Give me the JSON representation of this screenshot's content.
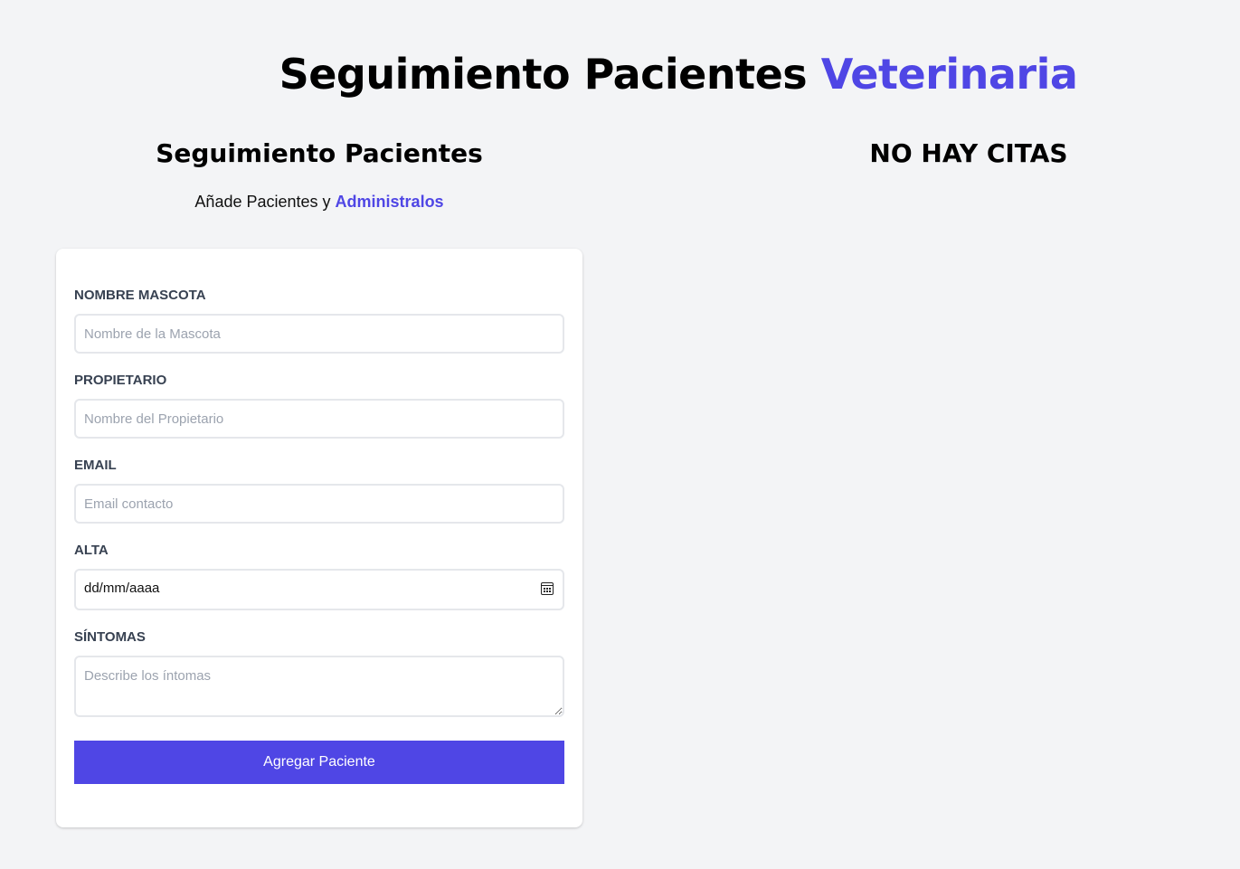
{
  "header": {
    "title_main": "Seguimiento Pacientes",
    "title_accent": "Veterinaria"
  },
  "form_section": {
    "title": "Seguimiento Pacientes",
    "tagline_text": "Añade Pacientes y",
    "tagline_accent": "Administralos"
  },
  "form": {
    "fields": [
      {
        "label": "Nombre Mascota",
        "placeholder": "Nombre de la Mascota",
        "value": ""
      },
      {
        "label": "Propietario",
        "placeholder": "Nombre del Propietario",
        "value": ""
      },
      {
        "label": "Email",
        "placeholder": "Email contacto",
        "value": ""
      },
      {
        "label": "Alta",
        "display_value": "dd/mm/aaaa",
        "icon": "calendar-icon"
      },
      {
        "label": "Síntomas",
        "placeholder": "Describe los íntomas",
        "value": ""
      }
    ],
    "submit_label": "Agregar Paciente"
  },
  "appointments": {
    "empty_title": "NO HAY CITAS"
  },
  "colors": {
    "accent": "#4f46e5",
    "background": "#f3f4f6",
    "card": "#ffffff",
    "label": "#374151",
    "placeholder": "#9ca3af"
  }
}
